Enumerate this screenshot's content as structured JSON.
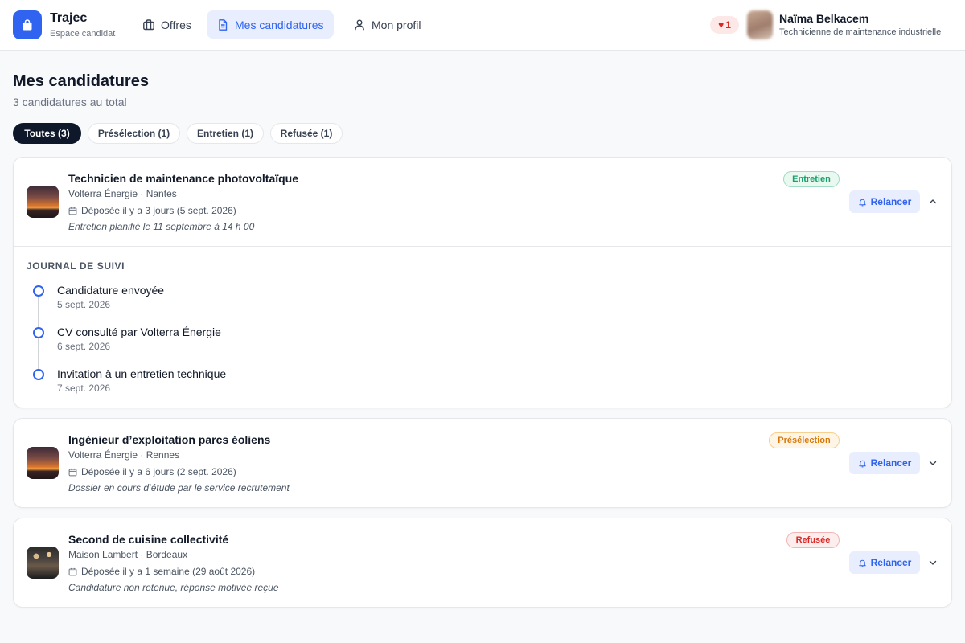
{
  "header": {
    "brand_name": "Trajec",
    "brand_sub": "Espace candidat",
    "nav": [
      {
        "label": "Offres",
        "icon": "briefcase-icon"
      },
      {
        "label": "Mes candidatures",
        "icon": "document-icon",
        "active": true
      },
      {
        "label": "Mon profil",
        "icon": "user-icon"
      }
    ],
    "favorites_count": "1",
    "user": {
      "name": "Naïma Belkacem",
      "role": "Technicienne de maintenance industrielle"
    }
  },
  "page": {
    "title": "Mes candidatures",
    "subtitle": "3 candidatures au total"
  },
  "filters": [
    {
      "label": "Toutes (3)",
      "active": true
    },
    {
      "label": "Présélection (1)"
    },
    {
      "label": "Entretien (1)"
    },
    {
      "label": "Refusée (1)"
    }
  ],
  "applications": [
    {
      "title": "Technicien de maintenance photovoltaïque",
      "company": "Volterra Énergie · Nantes",
      "date": "Déposée il y a 3 jours (5 sept. 2026)",
      "note": "Entretien planifié le 11 septembre à 14 h 00",
      "status": "Entretien",
      "action": "Relancer",
      "expanded": true,
      "journal": {
        "title": "JOURNAL DE SUIVI",
        "events": [
          {
            "label": "Candidature envoyée",
            "date": "5 sept. 2026"
          },
          {
            "label": "CV consulté par Volterra Énergie",
            "date": "6 sept. 2026"
          },
          {
            "label": "Invitation à un entretien technique",
            "date": "7 sept. 2026"
          }
        ]
      }
    },
    {
      "title": "Ingénieur d’exploitation parcs éoliens",
      "company": "Volterra Énergie · Rennes",
      "date": "Déposée il y a 6 jours (2 sept. 2026)",
      "note": "Dossier en cours d’étude par le service recrutement",
      "status": "Présélection",
      "action": "Relancer",
      "expanded": false
    },
    {
      "title": "Second de cuisine collectivité",
      "company": "Maison Lambert · Bordeaux",
      "date": "Déposée il y a 1 semaine (29 août 2026)",
      "note": "Candidature non retenue, réponse motivée reçue",
      "status": "Refusée",
      "action": "Relancer",
      "expanded": false
    }
  ],
  "colors": {
    "accent": "#2f63f0",
    "status_interview": "#15a36a",
    "status_shortlist": "#d97706",
    "status_refused": "#dc2626"
  }
}
